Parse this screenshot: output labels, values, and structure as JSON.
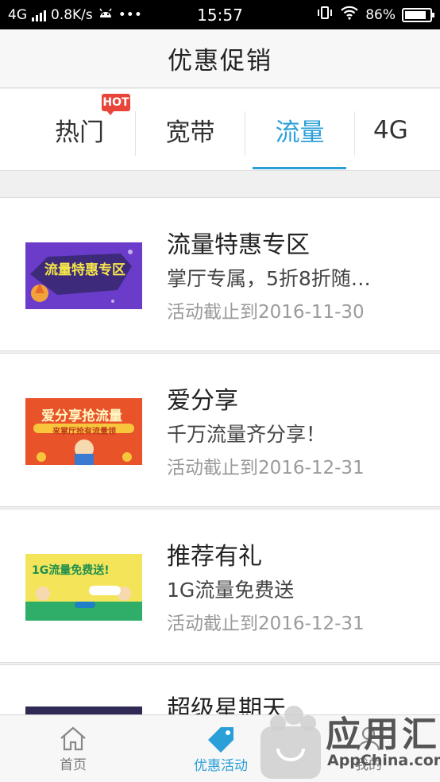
{
  "status_bar": {
    "network": "4G",
    "speed": "0.8K/s",
    "more": "•••",
    "time": "15:57",
    "battery": "86%",
    "battery_level": 0.86
  },
  "header": {
    "title": "优惠促销"
  },
  "tabs": [
    {
      "label": "热门",
      "badge": "HOT"
    },
    {
      "label": "宽带"
    },
    {
      "label": "流量",
      "active": true
    },
    {
      "label": "4G"
    }
  ],
  "promotions": [
    {
      "title": "流量特惠专区",
      "description": "掌厅专属，5折8折随…",
      "date": "活动截止到2016-11-30",
      "banner_text": "流量特惠专区",
      "colors": {
        "bg": "#6a3cc9"
      }
    },
    {
      "title": "爱分享",
      "description": "千万流量齐分享！",
      "date": "活动截止到2016-12-31",
      "banner_text": "爱分享抢流量",
      "banner_sub": "来掌厅抢有流量领",
      "colors": {
        "bg": "#e8532a"
      }
    },
    {
      "title": "推荐有礼",
      "description": "1G流量免费送",
      "date": "活动截止到2016-12-31",
      "banner_text": "1G流量免费送!",
      "colors": {
        "bg": "#f3e45a"
      }
    },
    {
      "title": "超级星期天",
      "colors": {
        "bg": "#2f2a55"
      }
    }
  ],
  "bottom_nav": [
    {
      "label": "首页",
      "icon": "home-icon"
    },
    {
      "label": "优惠活动",
      "icon": "tag-icon",
      "active": true
    },
    {
      "label": "我的",
      "icon": "user-icon"
    }
  ],
  "watermark": {
    "text": "应用汇",
    "sub": "AppChina.com"
  },
  "colors": {
    "accent": "#2a9fd8",
    "hot": "#e8443a"
  }
}
